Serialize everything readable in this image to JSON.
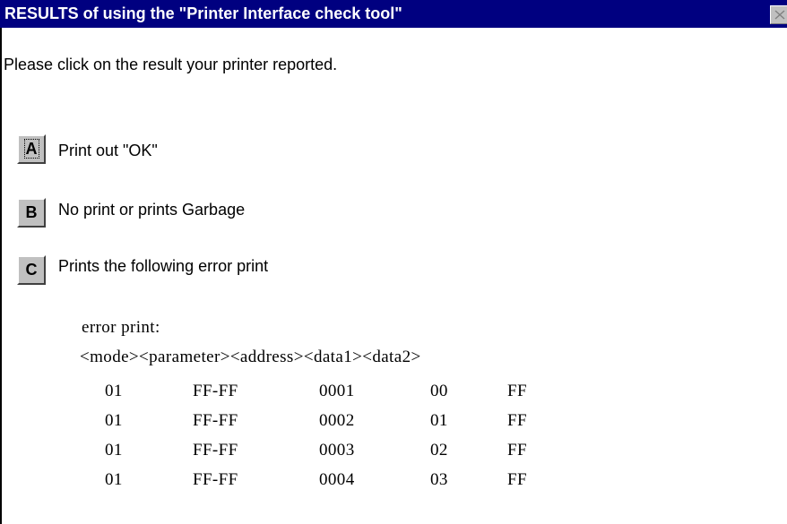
{
  "window": {
    "title": "RESULTS of using the \"Printer Interface check tool\""
  },
  "instruction": "Please click on the result your printer reported.",
  "options": [
    {
      "key": "A",
      "label": "Print out \"OK\""
    },
    {
      "key": "B",
      "label": "No print or prints Garbage"
    },
    {
      "key": "C",
      "label": "Prints the following error print"
    }
  ],
  "error_print": {
    "heading": "error print:",
    "header": "<mode><parameter><address><data1><data2>",
    "rows": [
      [
        "01",
        "FF-FF",
        "0001",
        "00",
        "FF"
      ],
      [
        "01",
        "FF-FF",
        "0002",
        "01",
        "FF"
      ],
      [
        "01",
        "FF-FF",
        "0003",
        "02",
        "FF"
      ],
      [
        "01",
        "FF-FF",
        "0004",
        "03",
        "FF"
      ]
    ]
  },
  "icons": {
    "close": "close-icon"
  },
  "colors": {
    "titlebar": "#000080",
    "title_text": "#ffffff",
    "button_face": "#c0c0c0"
  }
}
